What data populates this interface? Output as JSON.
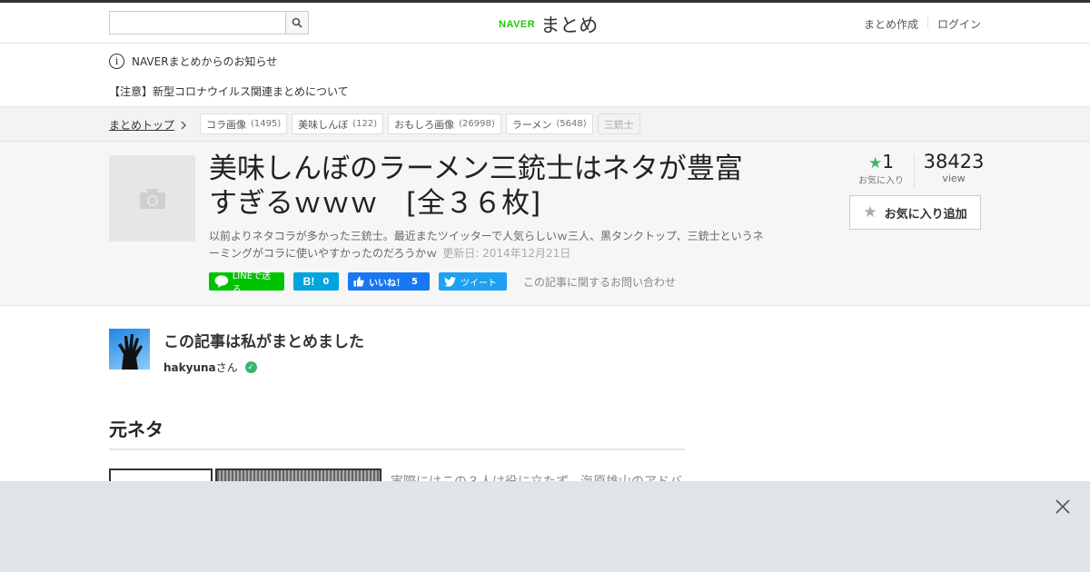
{
  "header": {
    "search_placeholder": "",
    "logo_naver": "NAVER",
    "logo_matome": "まとめ",
    "links": [
      "まとめ作成",
      "ログイン"
    ]
  },
  "notice": {
    "heading": "NAVERまとめからのお知らせ",
    "item": "【注意】新型コロナウイルス関連まとめについて"
  },
  "tagbar": {
    "breadcrumb": "まとめトップ",
    "tags": [
      {
        "label": "コラ画像",
        "count": "(1495)"
      },
      {
        "label": "美味しんぼ",
        "count": "(122)"
      },
      {
        "label": "おもしろ画像",
        "count": "(26998)"
      },
      {
        "label": "ラーメン",
        "count": "(5648)"
      },
      {
        "label": "三銃士",
        "count": ""
      }
    ]
  },
  "article": {
    "title": "美味しんぼのラーメン三銃士はネタが豊富すぎるｗｗｗ　[全３６枚]",
    "description": "以前よりネタコラが多かった三銃士。最近またツイッターで人気らしいｗ三人、黒タンクトップ、三銃士というネーミングがコラに使いやすかったのだろうかｗ",
    "updated": "更新日: 2014年12月21日",
    "favorites": "1",
    "favorites_label": "お気に入り",
    "views": "38423",
    "views_label": "view",
    "fav_button": "お気に入り追加",
    "share": {
      "line": "LINEで送る",
      "hatena_count": "0",
      "fb_label": "いいね！",
      "fb_count": "5",
      "tweet": "ツイート"
    },
    "inquiry": "この記事に関するお問い合わせ"
  },
  "author": {
    "heading": "この記事は私がまとめました",
    "name": "hakyuna",
    "suffix": "さん"
  },
  "section": {
    "title": "元ネタ",
    "text": "実際にはこの３人は役に立たず、海原雄山のアドバ"
  },
  "colors": {
    "naver_green": "#1ec800",
    "line_green": "#00c300",
    "hatena_blue": "#00a4de",
    "facebook_blue": "#1877f2",
    "twitter_blue": "#1da1f2",
    "ad_overlay": "#e0e4e7"
  }
}
